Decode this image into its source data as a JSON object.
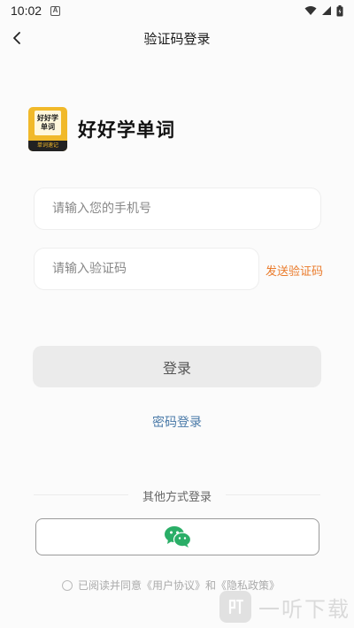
{
  "status_bar": {
    "time": "10:02",
    "a_icon_letter": "A"
  },
  "nav": {
    "title": "验证码登录",
    "back_icon": "chevron-left-icon"
  },
  "brand": {
    "app_name": "好好学单词",
    "logo_book_text": "好好学单词",
    "logo_strip_text": "单词速记",
    "logo_color": "#f1b92a"
  },
  "form": {
    "phone_placeholder": "请输入您的手机号",
    "phone_value": "",
    "code_placeholder": "请输入验证码",
    "code_value": "",
    "send_code_label": "发送验证码",
    "login_label": "登录",
    "password_login_label": "密码登录"
  },
  "other_login": {
    "label": "其他方式登录",
    "wechat_icon": "wechat-icon",
    "wechat_color": "#2aae67"
  },
  "agreement": {
    "prefix": "已阅读并同意",
    "user_agreement": "《用户协议》",
    "and": " 和 ",
    "privacy_policy": "《隐私政策》"
  },
  "watermark": {
    "text": "一听下载",
    "icon": "ting-logo-icon"
  },
  "colors": {
    "accent": "#ea7a2a",
    "link": "#4a7aa8",
    "button_bg": "#ebebeb"
  }
}
